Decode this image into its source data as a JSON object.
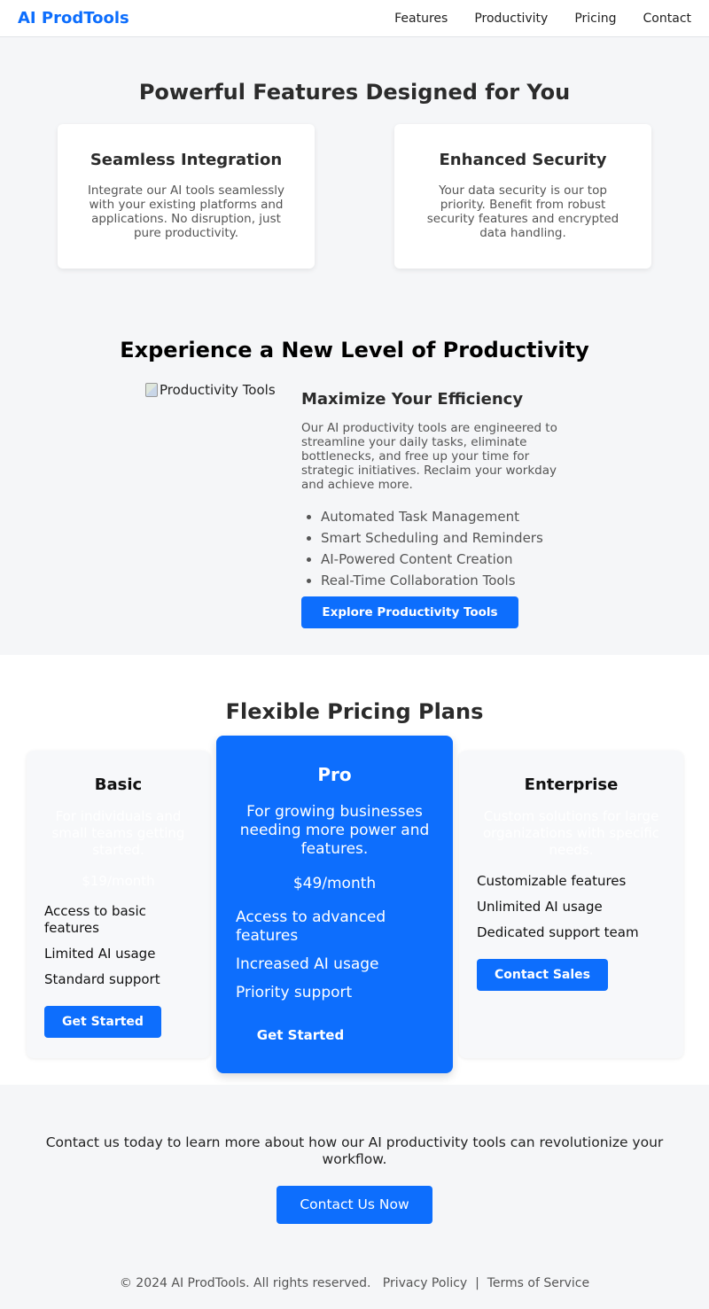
{
  "header": {
    "logo": "AI ProdTools",
    "nav": [
      "Features",
      "Productivity",
      "Pricing",
      "Contact"
    ]
  },
  "features": {
    "title": "Powerful Features Designed for You",
    "cards": [
      {
        "title": "Seamless Integration",
        "text": "Integrate our AI tools seamlessly with your existing platforms and applications. No disruption, just pure productivity."
      },
      {
        "title": "Enhanced Security",
        "text": "Your data security is our top priority. Benefit from robust security features and encrypted data handling."
      }
    ]
  },
  "productivity": {
    "title": "Experience a New Level of Productivity",
    "image_alt": "Productivity Tools",
    "heading": "Maximize Your Efficiency",
    "text": "Our AI productivity tools are engineered to streamline your daily tasks, eliminate bottlenecks, and free up your time for strategic initiatives. Reclaim your workday and achieve more.",
    "list": [
      "Automated Task Management",
      "Smart Scheduling and Reminders",
      "AI-Powered Content Creation",
      "Real-Time Collaboration Tools"
    ],
    "button": "Explore Productivity Tools"
  },
  "pricing": {
    "title": "Flexible Pricing Plans",
    "plans": [
      {
        "name": "Basic",
        "desc": "For individuals and small teams getting started.",
        "price": "$19/month",
        "features": [
          "Access to basic features",
          "Limited AI usage",
          "Standard support"
        ],
        "button": "Get Started"
      },
      {
        "name": "Pro",
        "desc": "For growing businesses needing more power and features.",
        "price": "$49/month",
        "features": [
          "Access to advanced features",
          "Increased AI usage",
          "Priority support"
        ],
        "button": "Get Started"
      },
      {
        "name": "Enterprise",
        "desc": "Custom solutions for large organizations with specific needs.",
        "features": [
          "Customizable features",
          "Unlimited AI usage",
          "Dedicated support team"
        ],
        "button": "Contact Sales"
      }
    ]
  },
  "contact": {
    "text": "Contact us today to learn more about how our AI productivity tools can revolutionize your workflow.",
    "button": "Contact Us Now"
  },
  "footer": {
    "copyright": "© 2024 AI ProdTools. All rights reserved.",
    "privacy": "Privacy Policy",
    "separator": "|",
    "terms": "Terms of Service"
  },
  "colors": {
    "accent": "#0d6efd",
    "background": "#f5f6f8"
  }
}
